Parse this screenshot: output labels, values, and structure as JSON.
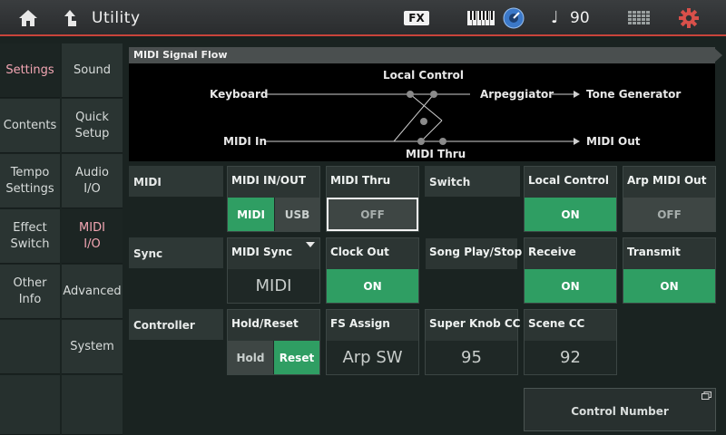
{
  "topbar": {
    "title": "Utility",
    "fx_label": "FX",
    "tempo_note": "♩",
    "tempo": "90",
    "icons": [
      "home-icon",
      "up-arrow-icon",
      "keyboard-icon",
      "dial-icon",
      "grid-icon",
      "gear-icon"
    ]
  },
  "nav": {
    "col1": [
      "Settings",
      "Contents",
      "Tempo Settings",
      "Effect Switch",
      "Other Info"
    ],
    "col2": [
      "Sound",
      "Quick Setup",
      "Audio I/O",
      "MIDI I/O",
      "Advanced",
      "System"
    ]
  },
  "flow": {
    "title": "MIDI Signal Flow",
    "keyboard": "Keyboard",
    "local_control": "Local Control",
    "arpeggiator": "Arpeggiator",
    "tone_generator": "Tone Generator",
    "midi_in": "MIDI In",
    "midi_thru": "MIDI Thru",
    "midi_out": "MIDI Out"
  },
  "rows": {
    "midi": "MIDI",
    "sync": "Sync",
    "controller": "Controller",
    "switch": "Switch"
  },
  "params": {
    "midi_in_out": {
      "title": "MIDI IN/OUT",
      "options": [
        "MIDI",
        "USB"
      ],
      "selected": "MIDI"
    },
    "midi_thru": {
      "title": "MIDI Thru",
      "value": "OFF"
    },
    "local_control": {
      "title": "Local Control",
      "value": "ON"
    },
    "arp_midi_out": {
      "title": "Arp MIDI Out",
      "value": "OFF"
    },
    "midi_sync": {
      "title": "MIDI Sync",
      "value": "MIDI"
    },
    "clock_out": {
      "title": "Clock Out",
      "value": "ON"
    },
    "song_play_stop": {
      "title": "Song Play/Stop"
    },
    "receive": {
      "title": "Receive",
      "value": "ON"
    },
    "transmit": {
      "title": "Transmit",
      "value": "ON"
    },
    "hold_reset": {
      "title": "Hold/Reset",
      "options": [
        "Hold",
        "Reset"
      ],
      "selected": "Reset"
    },
    "fs_assign": {
      "title": "FS Assign",
      "value": "Arp SW"
    },
    "super_knob_cc": {
      "title": "Super Knob CC",
      "value": "95"
    },
    "scene_cc": {
      "title": "Scene CC",
      "value": "92"
    }
  },
  "control_number": "Control Number",
  "colors": {
    "accent_red": "#c9443b",
    "on_green": "#2f9e63",
    "active_pink": "#f3a6b3"
  }
}
